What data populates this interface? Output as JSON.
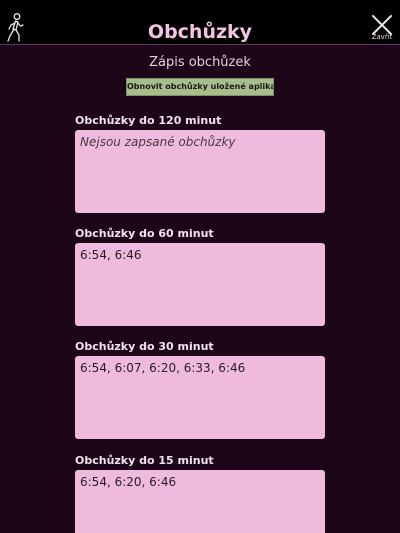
{
  "header": {
    "title": "Obchůzky",
    "close_label": "Zavřít",
    "left_icon": "walking-person-icon",
    "close_icon": "close-icon"
  },
  "subtitle": "Zápis obchůzek",
  "refresh_button": "Obnovit obchůzky uložené aplikací",
  "sections": [
    {
      "label": "Obchůzky do 120 minut",
      "value": "Nejsou zapsané obchůzky",
      "empty": true
    },
    {
      "label": "Obchůzky do 60 minut",
      "value": "6:54, 6:46",
      "empty": false
    },
    {
      "label": "Obchůzky do 30 minut",
      "value": "6:54, 6:07, 6:20, 6:33, 6:46",
      "empty": false
    },
    {
      "label": "Obchůzky do 15 minut",
      "value": "6:54, 6:20, 6:46",
      "empty": false
    }
  ],
  "colors": {
    "background": "#1e0619",
    "header": "#000000",
    "title": "#f2c3e2",
    "box": "#efbbdd",
    "button": "#a9bd8c"
  }
}
